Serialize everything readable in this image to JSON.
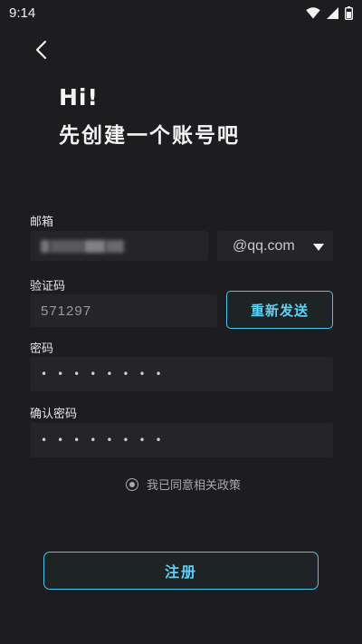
{
  "status_bar": {
    "time": "9:14",
    "icons": [
      "wifi-icon",
      "cellular-signal-icon",
      "battery-icon"
    ]
  },
  "nav": {
    "back_icon": "chevron-left-icon"
  },
  "header": {
    "greeting": "Hi!",
    "title": "先创建一个账号吧"
  },
  "form": {
    "email": {
      "label": "邮箱",
      "value": "",
      "domain": "@qq.com",
      "domain_icon": "caret-down-icon"
    },
    "code": {
      "label": "验证码",
      "value": "571297",
      "resend_label": "重新发送"
    },
    "password": {
      "label": "密码",
      "value": "••••••••"
    },
    "confirm_password": {
      "label": "确认密码",
      "value": "••••••••"
    },
    "agreement": {
      "text": "我已同意相关政策"
    }
  },
  "actions": {
    "register_label": "注册"
  },
  "colors": {
    "background": "#1d1d1f",
    "field_background": "#252527",
    "accent": "#4ec3ec"
  }
}
